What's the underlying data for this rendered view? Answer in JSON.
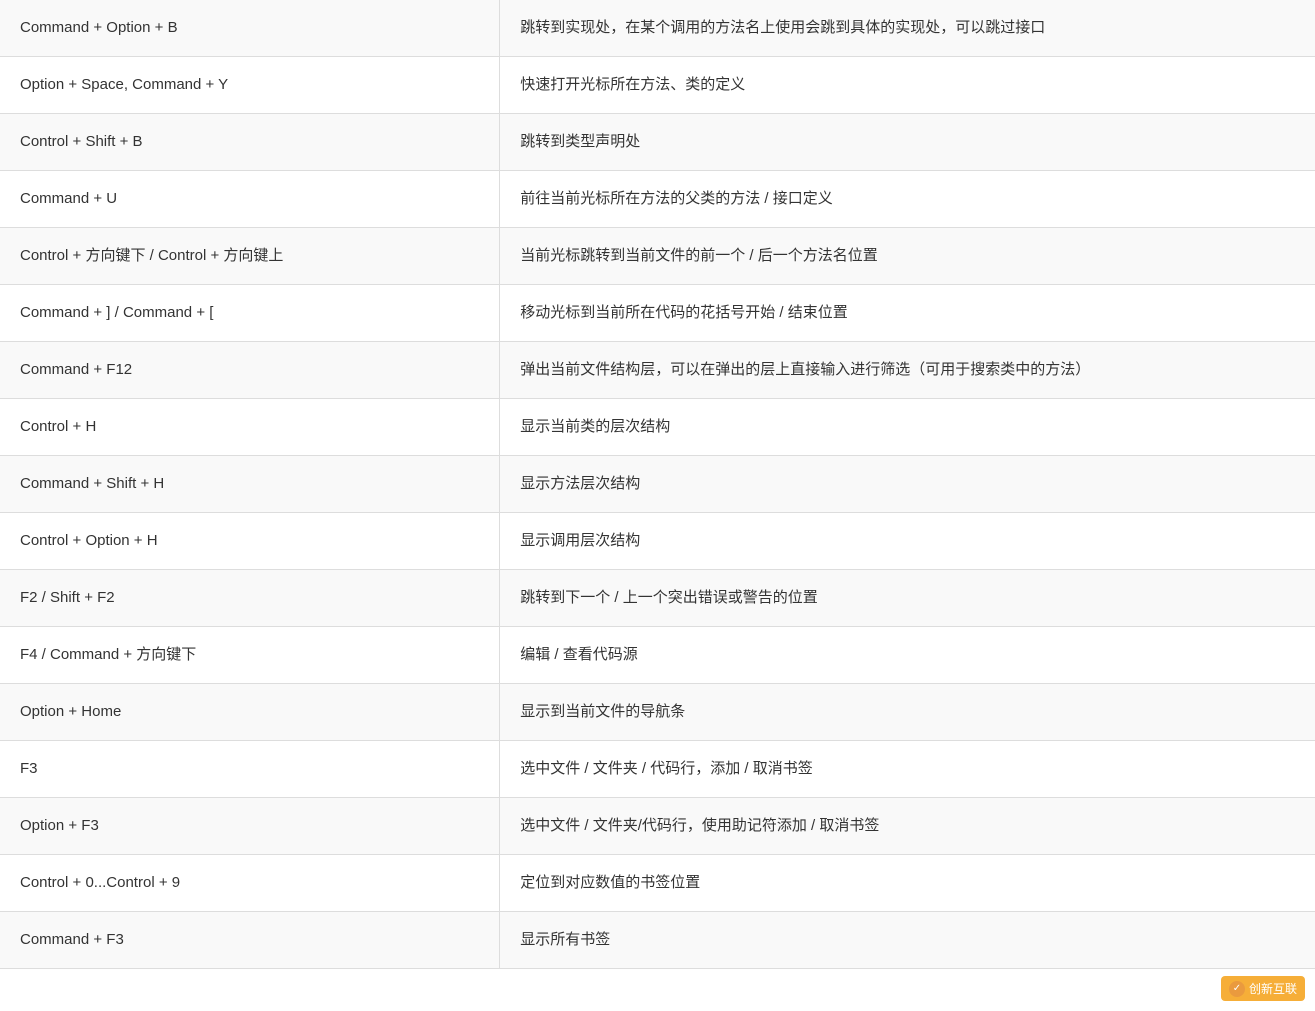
{
  "table": {
    "rows": [
      {
        "key": "Command + Option + B",
        "value": "跳转到实现处，在某个调用的方法名上使用会跳到具体的实现处，可以跳过接口"
      },
      {
        "key": "Option + Space, Command + Y",
        "value": "快速打开光标所在方法、类的定义"
      },
      {
        "key": "Control + Shift + B",
        "value": "跳转到类型声明处"
      },
      {
        "key": "Command + U",
        "value": "前往当前光标所在方法的父类的方法 / 接口定义"
      },
      {
        "key": "Control + 方向键下 / Control + 方向键上",
        "value": "当前光标跳转到当前文件的前一个 / 后一个方法名位置"
      },
      {
        "key": "Command + ] / Command + [",
        "value": "移动光标到当前所在代码的花括号开始 / 结束位置"
      },
      {
        "key": "Command + F12",
        "value": "弹出当前文件结构层，可以在弹出的层上直接输入进行筛选（可用于搜索类中的方法）"
      },
      {
        "key": "Control + H",
        "value": "显示当前类的层次结构"
      },
      {
        "key": "Command + Shift + H",
        "value": "显示方法层次结构"
      },
      {
        "key": "Control + Option + H",
        "value": "显示调用层次结构"
      },
      {
        "key": "F2 / Shift + F2",
        "value": "跳转到下一个 / 上一个突出错误或警告的位置"
      },
      {
        "key": "F4 / Command + 方向键下",
        "value": "编辑 / 查看代码源"
      },
      {
        "key": "Option + Home",
        "value": "显示到当前文件的导航条"
      },
      {
        "key": "F3",
        "value": "选中文件 / 文件夹 / 代码行，添加 / 取消书签"
      },
      {
        "key": "Option + F3",
        "value": "选中文件 / 文件夹/代码行，使用助记符添加 / 取消书签"
      },
      {
        "key": "Control + 0...Control + 9",
        "value": "定位到对应数值的书签位置"
      },
      {
        "key": "Command + F3",
        "value": "显示所有书签"
      }
    ]
  },
  "watermark": {
    "label": "创新互联"
  }
}
